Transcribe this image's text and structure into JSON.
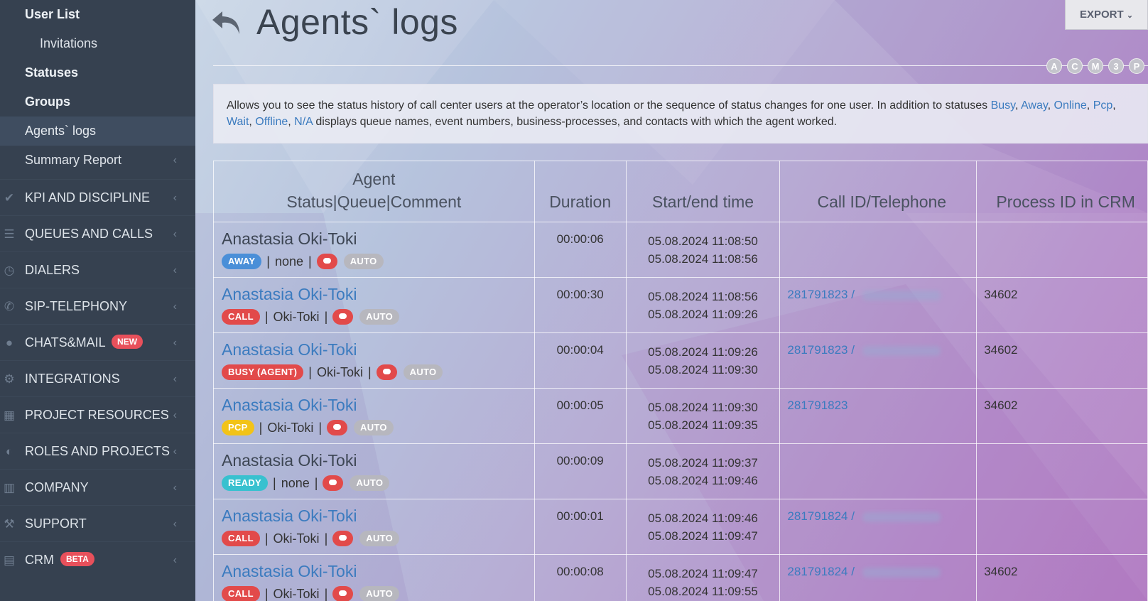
{
  "sidebar": {
    "sub_items": [
      {
        "label": "User List"
      },
      {
        "label": "Invitations"
      },
      {
        "label": "Statuses"
      },
      {
        "label": "Groups"
      },
      {
        "label": "Agents` logs"
      },
      {
        "label": "Summary Report"
      }
    ],
    "main_items": [
      {
        "label": "KPI AND DISCIPLINE",
        "icon": "check-icon"
      },
      {
        "label": "QUEUES AND CALLS",
        "icon": "list-icon"
      },
      {
        "label": "DIALERS",
        "icon": "clock-icon"
      },
      {
        "label": "SIP-TELEPHONY",
        "icon": "phone-icon"
      },
      {
        "label": "CHATS&MAIL",
        "icon": "chat-bubble-icon",
        "badge": "NEW"
      },
      {
        "label": "INTEGRATIONS",
        "icon": "gears-icon"
      },
      {
        "label": "PROJECT RESOURCES",
        "icon": "grid-icon"
      },
      {
        "label": "ROLES AND PROJECTS",
        "icon": "toggle-icon"
      },
      {
        "label": "COMPANY",
        "icon": "bar-chart-icon"
      },
      {
        "label": "SUPPORT",
        "icon": "wrench-icon"
      },
      {
        "label": "CRM",
        "icon": "crm-icon",
        "badge": "BETA"
      }
    ]
  },
  "header": {
    "title": "Agents` logs",
    "export_label": "EXPORT",
    "circles": [
      "A",
      "C",
      "M",
      "3",
      "P"
    ]
  },
  "info": {
    "text_before": "Allows you to see the status history of call center users at the operator’s location or the sequence of status changes for one user. In addition to statuses ",
    "statuses": [
      "Busy",
      "Away",
      "Online",
      "Pcp",
      "Wait",
      "Offline",
      "N/A"
    ],
    "text_after": " displays queue names, event numbers, business-processes, and contacts with which the agent worked."
  },
  "table": {
    "headers": {
      "agent_line1": "Agent",
      "agent_line2": "Status|Queue|Comment",
      "duration": "Duration",
      "time": "Start/end time",
      "call": "Call ID/Telephone",
      "process": "Process ID in CRM"
    },
    "auto_label": "AUTO",
    "rows": [
      {
        "agent": "Anastasia Oki-Toki",
        "status": "AWAY",
        "queue": "none",
        "duration": "00:00:06",
        "start": "05.08.2024 11:08:50",
        "end": "05.08.2024 11:08:56",
        "call_id": "",
        "process_id": ""
      },
      {
        "agent": "Anastasia Oki-Toki",
        "status": "CALL",
        "queue": "Oki-Toki",
        "duration": "00:00:30",
        "start": "05.08.2024 11:08:56",
        "end": "05.08.2024 11:09:26",
        "call_id": "281791823 /",
        "process_id": "34602"
      },
      {
        "agent": "Anastasia Oki-Toki",
        "status": "BUSY (AGENT)",
        "queue": "Oki-Toki",
        "duration": "00:00:04",
        "start": "05.08.2024 11:09:26",
        "end": "05.08.2024 11:09:30",
        "call_id": "281791823 /",
        "process_id": "34602"
      },
      {
        "agent": "Anastasia Oki-Toki",
        "status": "PCP",
        "queue": "Oki-Toki",
        "duration": "00:00:05",
        "start": "05.08.2024 11:09:30",
        "end": "05.08.2024 11:09:35",
        "call_id": "281791823",
        "process_id": "34602"
      },
      {
        "agent": "Anastasia Oki-Toki",
        "status": "READY",
        "queue": "none",
        "duration": "00:00:09",
        "start": "05.08.2024 11:09:37",
        "end": "05.08.2024 11:09:46",
        "call_id": "",
        "process_id": ""
      },
      {
        "agent": "Anastasia Oki-Toki",
        "status": "CALL",
        "queue": "Oki-Toki",
        "duration": "00:00:01",
        "start": "05.08.2024 11:09:46",
        "end": "05.08.2024 11:09:47",
        "call_id": "281791824 /",
        "process_id": ""
      },
      {
        "agent": "Anastasia Oki-Toki",
        "status": "CALL",
        "queue": "Oki-Toki",
        "duration": "00:00:08",
        "start": "05.08.2024 11:09:47",
        "end": "05.08.2024 11:09:55",
        "call_id": "281791824 /",
        "process_id": "34602"
      }
    ]
  },
  "colors": {
    "sidebar_bg": "#364150",
    "link": "#3b7bbf",
    "away": "#4a8fd8",
    "call": "#e24a4a",
    "pcp": "#f2c318",
    "ready": "#38c1cf",
    "auto": "#b7b7be"
  }
}
